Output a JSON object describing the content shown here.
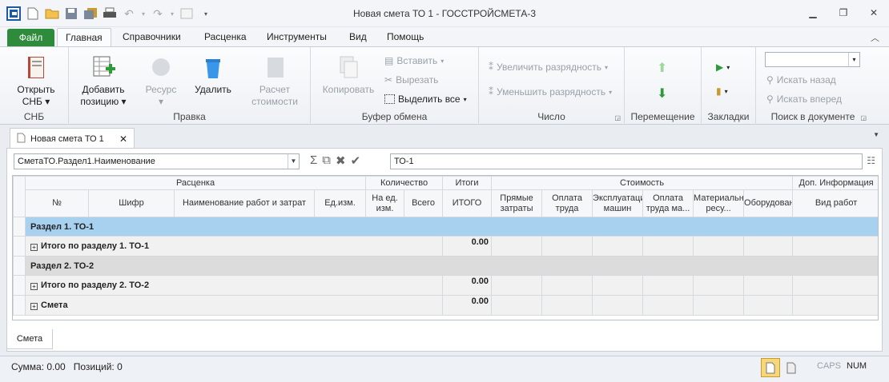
{
  "window": {
    "title": "Новая смета ТО 1 - ГОССТРОЙСМЕТА-3"
  },
  "ribbon_tabs": {
    "file": "Файл",
    "home": "Главная",
    "refs": "Справочники",
    "pricing": "Расценка",
    "tools": "Инструменты",
    "view": "Вид",
    "help": "Помощь"
  },
  "ribbon": {
    "snb": {
      "open1": "Открыть",
      "open2": "СНБ ▾",
      "label": "СНБ"
    },
    "edit": {
      "add1": "Добавить",
      "add2": "позицию ▾",
      "resource1": "Ресурс",
      "resource2": "▾",
      "delete": "Удалить",
      "calc1": "Расчет",
      "calc2": "стоимости",
      "label": "Правка"
    },
    "clipboard": {
      "copy": "Копировать",
      "paste": "Вставить",
      "cut": "Вырезать",
      "selectall": "Выделить все",
      "label": "Буфер обмена"
    },
    "number": {
      "inc": "Увеличить разрядность",
      "dec": "Уменьшить разрядность",
      "label": "Число"
    },
    "move": {
      "label": "Перемещение"
    },
    "bookmarks": {
      "label": "Закладки"
    },
    "search": {
      "back": "Искать назад",
      "fwd": "Искать вперед",
      "label": "Поиск в документе"
    }
  },
  "doc_tab": "Новая смета ТО 1",
  "formula": {
    "field": "СметаТО.Раздел1.Наименование",
    "value": "ТО-1"
  },
  "grid": {
    "band_headers": [
      "Расценка",
      "Количество",
      "Итоги",
      "Стоимость",
      "Доп. Информация"
    ],
    "col_headers": [
      "№",
      "Шифр",
      "Наименование работ и затрат",
      "Ед.изм.",
      "На ед. изм.",
      "Всего",
      "ИТОГО",
      "Прямые затраты",
      "Оплата труда",
      "Эксплуатация машин",
      "Оплата труда ма...",
      "Материальные ресу...",
      "Оборудование",
      "Вид работ"
    ],
    "rows": [
      {
        "type": "section_selected",
        "label": "Раздел 1. ТО-1"
      },
      {
        "type": "summary",
        "label": "Итого по разделу 1. ТО-1",
        "total": "0.00"
      },
      {
        "type": "section",
        "label": "Раздел 2. ТО-2"
      },
      {
        "type": "summary",
        "label": "Итого по разделу 2. ТО-2",
        "total": "0.00"
      },
      {
        "type": "summary",
        "label": "Смета",
        "total": "0.00"
      }
    ]
  },
  "sheet_tab": "Смета",
  "status": {
    "sum": "Сумма: 0.00",
    "positions": "Позиций:  0",
    "caps": "CAPS",
    "num": "NUM"
  }
}
